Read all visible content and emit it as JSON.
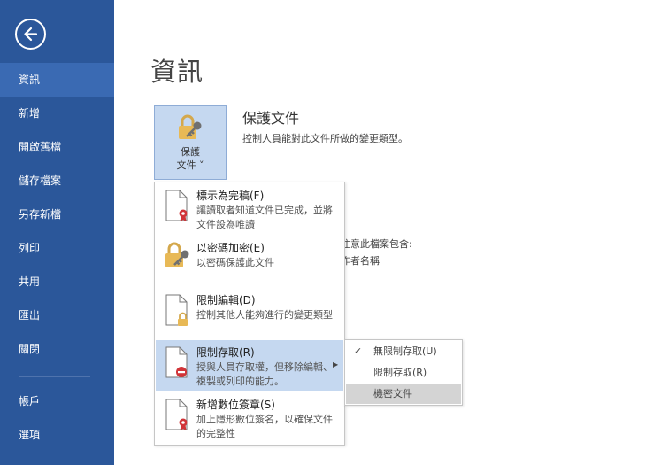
{
  "sidebar": {
    "items": [
      {
        "label": "資訊",
        "active": true
      },
      {
        "label": "新增"
      },
      {
        "label": "開啟舊檔"
      },
      {
        "label": "儲存檔案"
      },
      {
        "label": "另存新檔"
      },
      {
        "label": "列印"
      },
      {
        "label": "共用"
      },
      {
        "label": "匯出"
      },
      {
        "label": "關閉"
      },
      {
        "label": "帳戶"
      },
      {
        "label": "選項"
      }
    ]
  },
  "page_title": "資訊",
  "protect": {
    "button_line1": "保護",
    "button_line2": "文件 ˅",
    "title": "保護文件",
    "description": "控制人員能對此文件所做的變更類型。"
  },
  "background_text": {
    "line1": "注意此檔案包含:",
    "line2": "作者名稱"
  },
  "menu": {
    "items": [
      {
        "title": "標示為完稿(F)",
        "desc": "讓讀取者知道文件已完成，並將文件設為唯讀"
      },
      {
        "title": "以密碼加密(E)",
        "desc": "以密碼保護此文件"
      },
      {
        "title": "限制編輯(D)",
        "desc": "控制其他人能夠進行的變更類型"
      },
      {
        "title": "限制存取(R)",
        "desc": "授與人員存取權，但移除編輯、複製或列印的能力。"
      },
      {
        "title": "新增數位簽章(S)",
        "desc": "加上隱形數位簽名，以確保文件的完整性"
      }
    ]
  },
  "submenu": {
    "items": [
      {
        "label": "無限制存取(U)",
        "checked": true
      },
      {
        "label": "限制存取(R)"
      },
      {
        "label": "機密文件",
        "selected": true
      }
    ],
    "check_mark": "✓"
  },
  "colors": {
    "sidebar_bg": "#2b579a",
    "sidebar_active": "#3a6ab3",
    "hover_bg": "#c5d8f0",
    "submenu_selected": "#d4d4d4",
    "ribbon_red": "#d13438"
  },
  "icons": {
    "back": "back-arrow-icon",
    "protect": "lock-key-icon",
    "final": "document-ribbon-icon",
    "encrypt": "lock-key-icon",
    "restrict_edit": "document-lock-icon",
    "restrict_access": "document-no-entry-icon",
    "signature": "document-ribbon-icon",
    "submenu": "chevron-right-icon",
    "check": "check-icon"
  }
}
